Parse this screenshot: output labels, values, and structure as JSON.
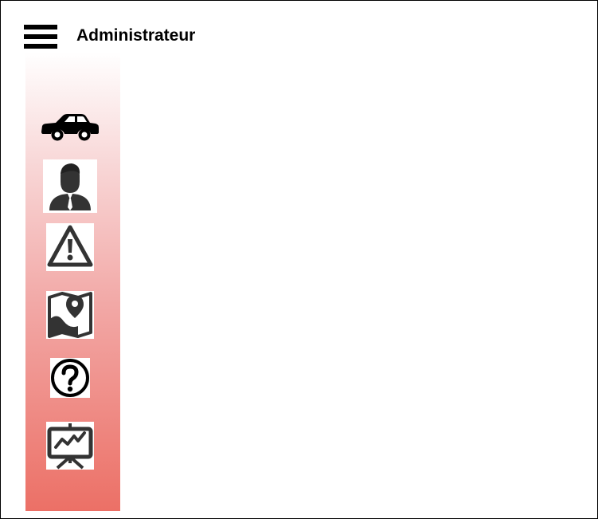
{
  "header": {
    "title": "Administrateur",
    "menu_icon": "hamburger-menu-icon"
  },
  "sidebar": {
    "gradient_colors": [
      "#ffffff",
      "#ec7066"
    ],
    "items": [
      {
        "icon": "car-icon"
      },
      {
        "icon": "user-icon"
      },
      {
        "icon": "warning-icon"
      },
      {
        "icon": "map-pin-icon"
      },
      {
        "icon": "help-icon"
      },
      {
        "icon": "presentation-chart-icon"
      }
    ]
  },
  "colors": {
    "icon": "#333333",
    "text": "#000000",
    "accent": "#ec7066"
  }
}
